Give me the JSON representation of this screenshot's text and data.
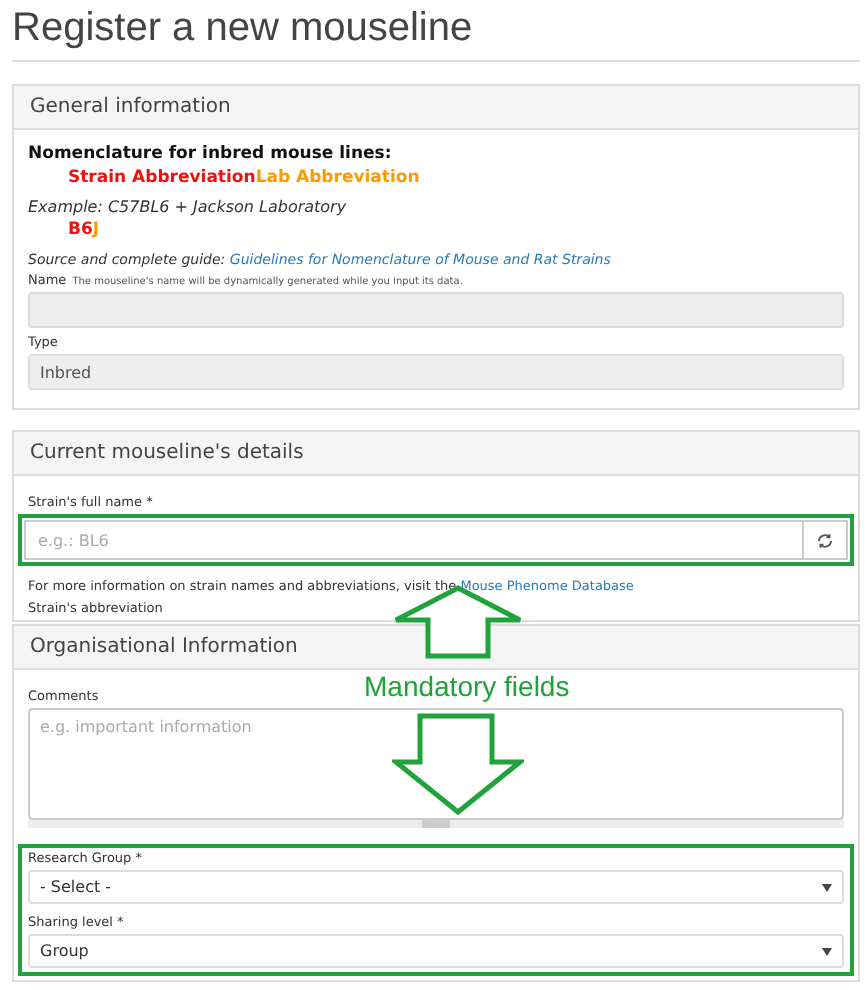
{
  "page_title": "Register a new mouseline",
  "general": {
    "title": "General information",
    "nomenclature_heading": "Nomenclature for inbred mouse lines:",
    "nomenclature_parts": [
      {
        "text": "Strain Abbreviation",
        "color": "#ee1111"
      },
      {
        "text": "Lab Abbreviation",
        "color": "#ff9900"
      }
    ],
    "example": "Example: C57BL6 + Jackson Laboratory",
    "example_parts": [
      {
        "text": "B6",
        "color": "#ee1111"
      },
      {
        "text": "J",
        "color": "#ff9900"
      }
    ],
    "source_label": "Source and complete guide:",
    "source_link": "Guidelines for Nomenclature of Mouse and Rat Strains",
    "name_label": "Name",
    "name_hint": "The mouseline's name will be dynamically generated while you input its data.",
    "type_label": "Type",
    "type_value": "Inbred"
  },
  "details": {
    "title": "Current mouseline's details",
    "strain_label": "Strain's full name *",
    "strain_placeholder": "e.g.: BL6",
    "help_text": "For more information on strain names and abbreviations, visit the",
    "help_link": "Mouse Phenome Database",
    "abbreviation_label": "Strain's abbreviation"
  },
  "organisation": {
    "title": "Organisational Information",
    "comments_label": "Comments",
    "comments_placeholder": "e.g. important information",
    "research_group_label": "Research Group *",
    "research_group_value": "- Select -",
    "sharing_label": "Sharing level *",
    "sharing_value": "Group"
  },
  "annotation": "Mandatory fields"
}
